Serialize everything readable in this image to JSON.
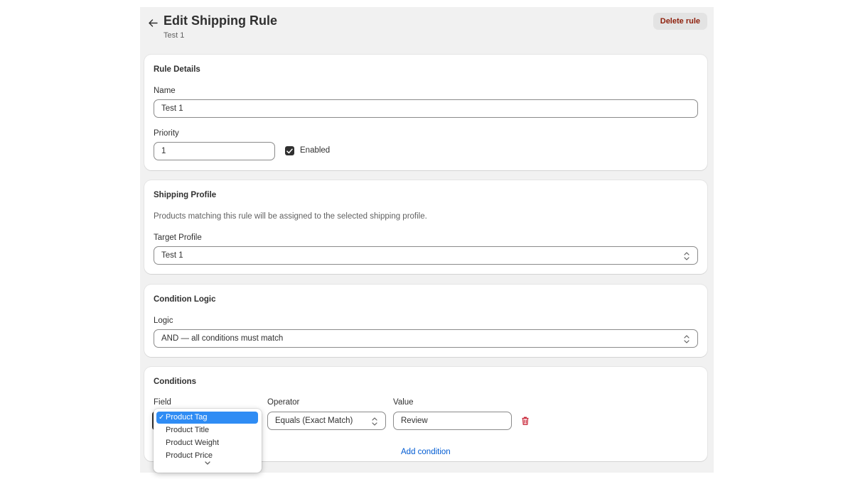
{
  "header": {
    "title": "Edit Shipping Rule",
    "subtitle": "Test 1",
    "delete_label": "Delete rule"
  },
  "rule_details": {
    "title": "Rule Details",
    "name_label": "Name",
    "name_value": "Test 1",
    "priority_label": "Priority",
    "priority_value": "1",
    "enabled_label": "Enabled",
    "enabled": true
  },
  "shipping_profile": {
    "title": "Shipping Profile",
    "description": "Products matching this rule will be assigned to the selected shipping profile.",
    "target_label": "Target Profile",
    "target_value": "Test 1"
  },
  "condition_logic": {
    "title": "Condition Logic",
    "logic_label": "Logic",
    "logic_value": "AND — all conditions must match"
  },
  "conditions": {
    "title": "Conditions",
    "field_label": "Field",
    "operator_label": "Operator",
    "value_label": "Value",
    "operator_value": "Equals (Exact Match)",
    "value_value": "Review",
    "add_label": "Add condition",
    "field_options": [
      "Product Tag",
      "Product Title",
      "Product Weight",
      "Product Price"
    ],
    "selected_field": "Product Tag"
  },
  "colors": {
    "primary_text": "#303030",
    "danger": "#8e1f0b",
    "link": "#005bd3",
    "dropdown_highlight": "#2f8cf4",
    "trash_icon": "#c9283a"
  }
}
